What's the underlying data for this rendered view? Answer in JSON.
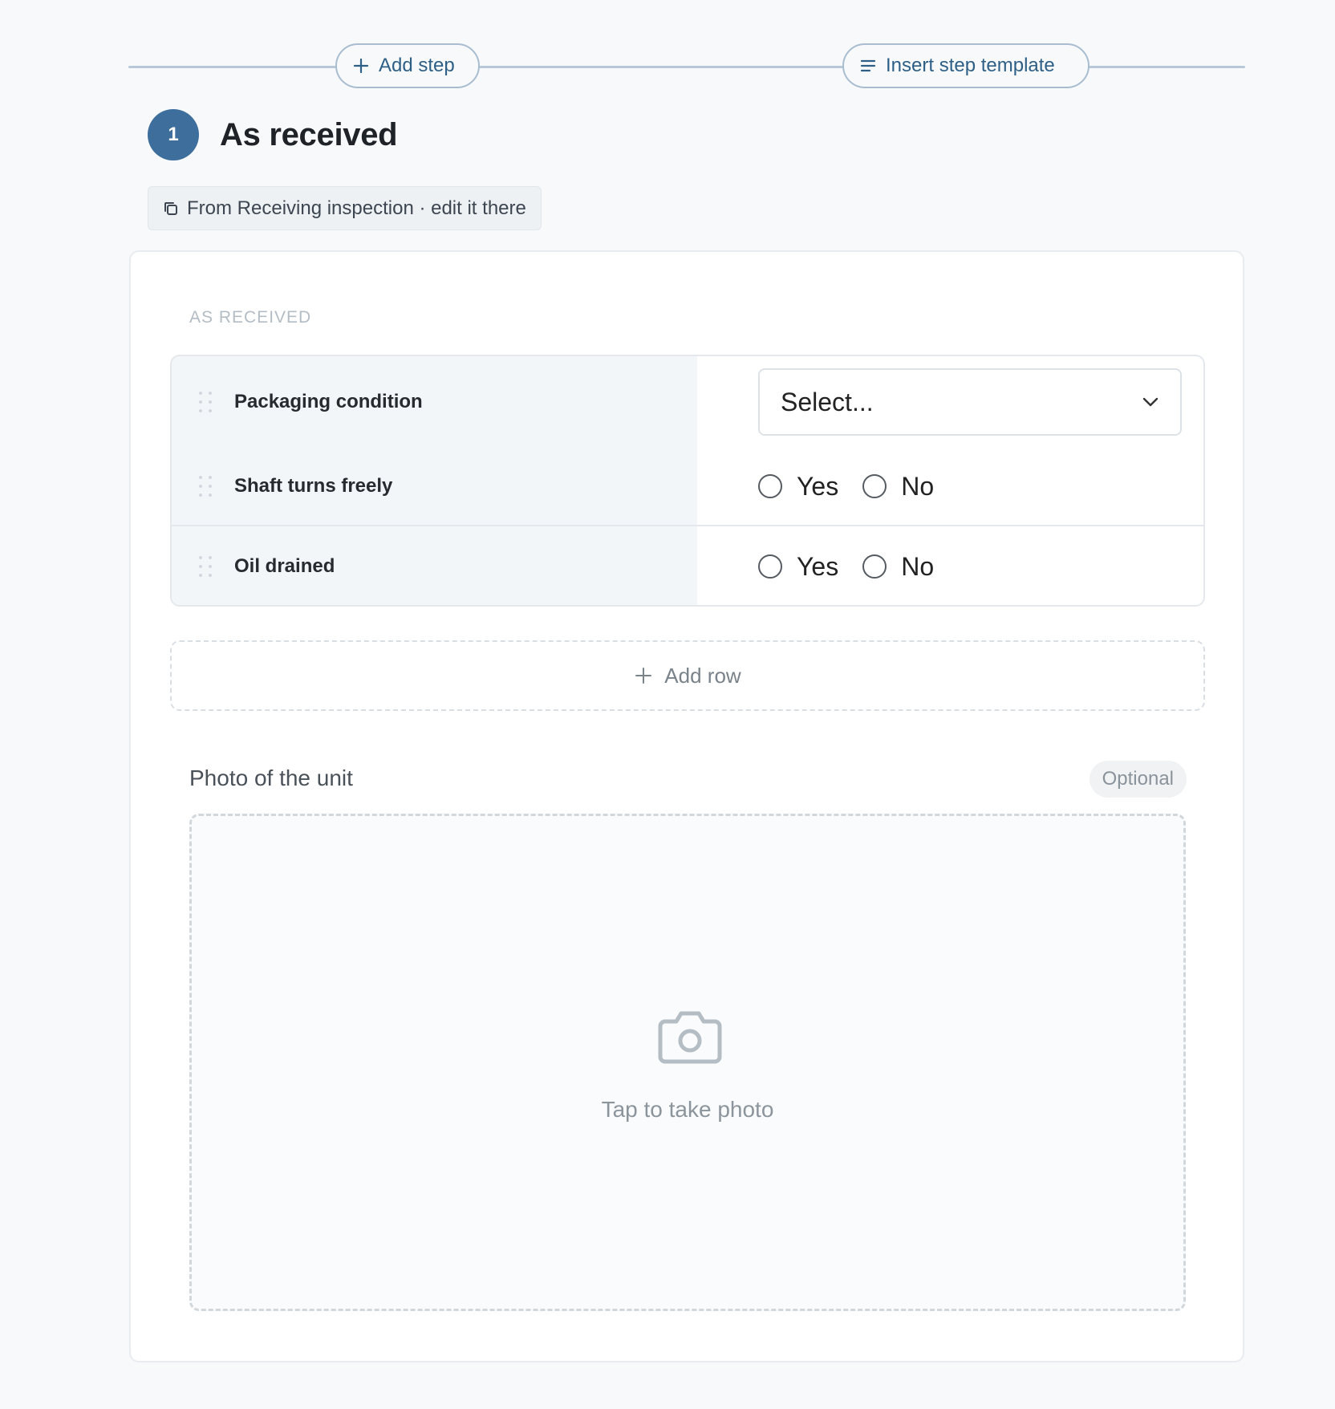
{
  "toolbar": {
    "add_step_label": "Add step",
    "insert_template_label": "Insert step template"
  },
  "step": {
    "number": "1",
    "title": "As received",
    "source_note": "From Receiving inspection · edit it there"
  },
  "section": {
    "label": "AS RECEIVED",
    "rows": [
      {
        "label": "Packaging condition",
        "type": "select",
        "placeholder": "Select..."
      },
      {
        "label": "Shaft turns freely",
        "type": "yes-no",
        "options": [
          "Yes",
          "No"
        ]
      },
      {
        "label": "Oil drained",
        "type": "yes-no",
        "options": [
          "Yes",
          "No"
        ]
      }
    ],
    "add_row_label": "Add row"
  },
  "photo": {
    "label": "Photo of the unit",
    "badge": "Optional",
    "hint": "Tap to take photo"
  },
  "colors": {
    "accent": "#3e6e9c",
    "link": "#2e5f86",
    "divider": "#b8c8d8"
  }
}
